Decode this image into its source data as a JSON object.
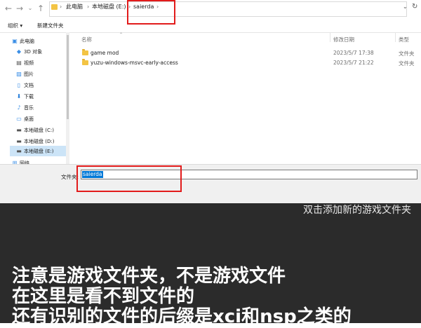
{
  "address_bar": {
    "breadcrumb": [
      "此电脑",
      "本地磁盘 (E:)",
      "saierda"
    ],
    "separator": "›"
  },
  "toolbar": {
    "organize_label": "组织 ▾",
    "new_folder_label": "新建文件夹"
  },
  "sidebar": {
    "items": [
      {
        "label": "此电脑",
        "icon": "computer-icon"
      },
      {
        "label": "3D 对象",
        "icon": "cube-icon"
      },
      {
        "label": "视频",
        "icon": "video-icon"
      },
      {
        "label": "图片",
        "icon": "picture-icon"
      },
      {
        "label": "文档",
        "icon": "document-icon"
      },
      {
        "label": "下载",
        "icon": "download-icon"
      },
      {
        "label": "音乐",
        "icon": "music-icon"
      },
      {
        "label": "桌面",
        "icon": "desktop-icon"
      },
      {
        "label": "本地磁盘 (C:)",
        "icon": "drive-icon"
      },
      {
        "label": "本地磁盘 (D:)",
        "icon": "drive-icon"
      },
      {
        "label": "本地磁盘 (E:)",
        "icon": "drive-icon",
        "selected": true
      },
      {
        "label": "网络",
        "icon": "network-icon"
      }
    ]
  },
  "file_list": {
    "columns": {
      "name": "名称",
      "date": "修改日期",
      "type": "类型"
    },
    "rows": [
      {
        "name": "game mod",
        "date": "2023/5/7 17:38",
        "type": "文件夹"
      },
      {
        "name": "yuzu-windows-msvc-early-access",
        "date": "2023/5/7 21:22",
        "type": "文件夹"
      }
    ]
  },
  "folder_field": {
    "label": "文件夹:",
    "value": "saierda"
  },
  "overlay": {
    "hint": "双击添加新的游戏文件夹",
    "captions": [
      "注意是游戏文件夹，不是游戏文件",
      "在这里是看不到文件的",
      "还有识别的文件的后缀是xci和nsp之类的"
    ]
  },
  "colors": {
    "highlight_red": "#e21b1b",
    "selection_blue": "#0078d7",
    "folder_yellow": "#f3c444",
    "caption_bg": "#2b2b2b"
  }
}
